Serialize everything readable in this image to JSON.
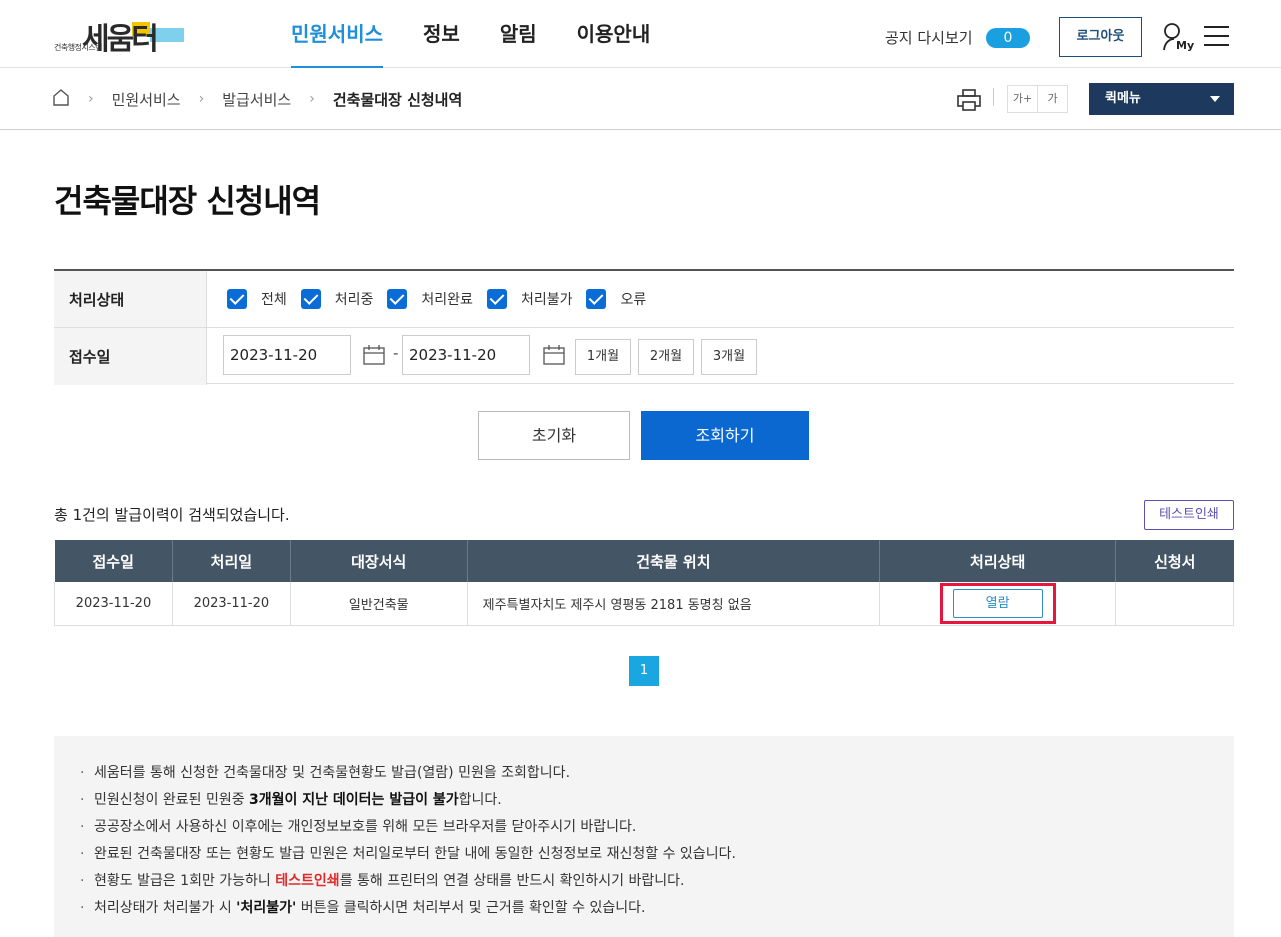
{
  "header": {
    "logo_text": "세움터",
    "logo_sub": "건축행정시스템",
    "nav": [
      {
        "label": "민원서비스",
        "active": true
      },
      {
        "label": "정보",
        "active": false
      },
      {
        "label": "알림",
        "active": false
      },
      {
        "label": "이용안내",
        "active": false
      }
    ],
    "notice_label": "공지 다시보기",
    "notice_count": "0",
    "logout_label": "로그아웃",
    "my_label": "My"
  },
  "breadcrumb": {
    "items": [
      "민원서비스",
      "발급서비스"
    ],
    "current": "건축물대장 신청내역",
    "font_plus": "가+",
    "font_normal": "가",
    "quick_menu": "퀵메뉴"
  },
  "page": {
    "title": "건축물대장 신청내역"
  },
  "search": {
    "status_label": "처리상태",
    "statuses": [
      {
        "label": "전체",
        "checked": true
      },
      {
        "label": "처리중",
        "checked": true
      },
      {
        "label": "처리완료",
        "checked": true
      },
      {
        "label": "처리불가",
        "checked": true
      },
      {
        "label": "오류",
        "checked": true
      }
    ],
    "date_label": "접수일",
    "date_from": "2023-11-20",
    "date_to": "2023-11-20",
    "dash": "-",
    "periods": [
      "1개월",
      "2개월",
      "3개월"
    ],
    "reset_label": "초기화",
    "search_label": "조회하기"
  },
  "results": {
    "count_text": "총 1건의 발급이력이 검색되었습니다.",
    "test_print_label": "테스트인쇄",
    "columns": [
      "접수일",
      "처리일",
      "대장서식",
      "건축물 위치",
      "처리상태",
      "신청서"
    ],
    "rows": [
      {
        "received": "2023-11-20",
        "processed": "2023-11-20",
        "form": "일반건축물",
        "location": "제주특별자치도 제주시 영평동 2181 동명칭 없음",
        "status_button": "열람",
        "application": ""
      }
    ],
    "page": "1"
  },
  "info": {
    "bullet": "·",
    "items": [
      {
        "pre": "세움터를 통해 신청한 건축물대장 및 건축물현황도 발급(열람) 민원을 조회합니다.",
        "bold": "",
        "post": ""
      },
      {
        "pre": "민원신청이 완료된 민원중 ",
        "bold": "3개월이 지난 데이터는 발급이 불가",
        "post": "합니다."
      },
      {
        "pre": "공공장소에서 사용하신 이후에는 개인정보보호를 위해 모든 브라우저를 닫아주시기 바랍니다.",
        "bold": "",
        "post": ""
      },
      {
        "pre": "완료된 건축물대장 또는 현황도 발급 민원은 처리일로부터 한달 내에 동일한 신청정보로 재신청할 수 있습니다.",
        "bold": "",
        "post": ""
      },
      {
        "pre": "현황도 발급은 1회만 가능하니 ",
        "red": "테스트인쇄",
        "post": "를 통해 프린터의 연결 상태를 반드시 확인하시기 바랍니다."
      },
      {
        "pre": "처리상태가 처리불가 시 ",
        "bold": "'처리불가'",
        "post": " 버튼을 클릭하시면 처리부서 및 근거를 확인할 수 있습니다."
      }
    ]
  },
  "colors": {
    "accent": "#1e8fd8",
    "primary_button": "#0a68d0",
    "table_header": "#445566",
    "highlight": "#e5173f"
  }
}
